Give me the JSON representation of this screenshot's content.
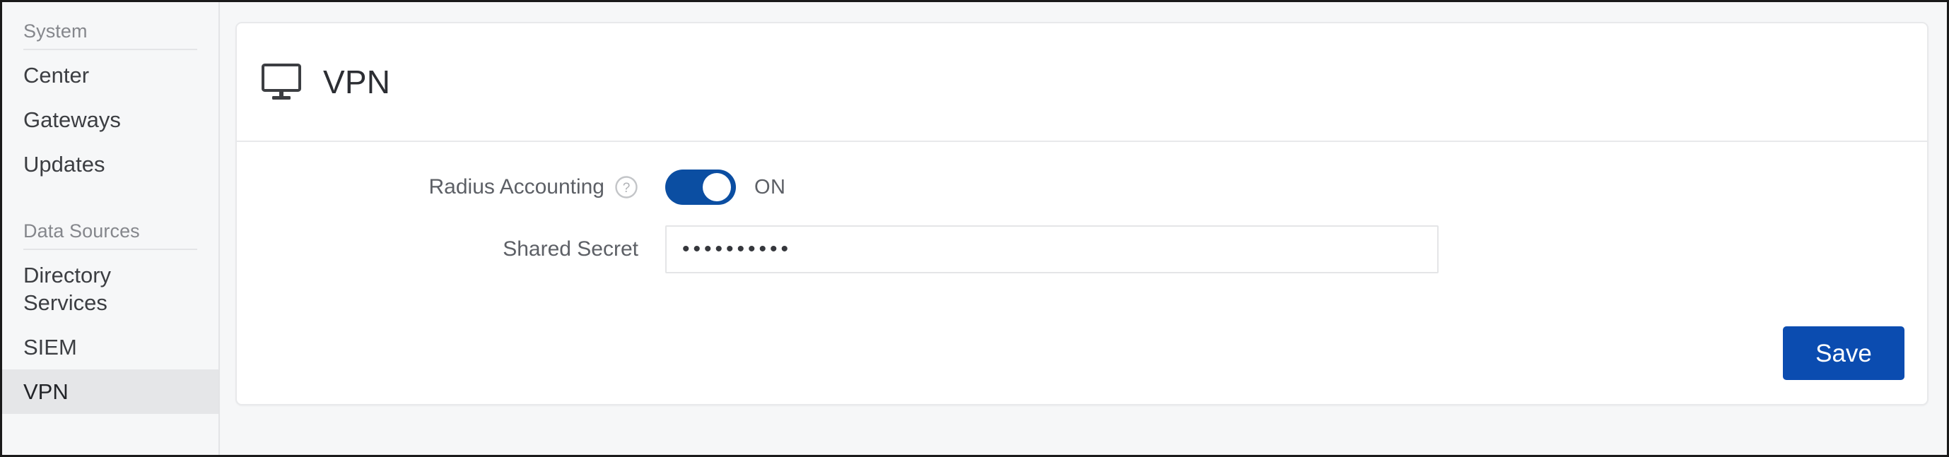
{
  "sidebar": {
    "sections": [
      {
        "title": "System",
        "items": [
          {
            "label": "Center",
            "active": false
          },
          {
            "label": "Gateways",
            "active": false
          },
          {
            "label": "Updates",
            "active": false
          }
        ]
      },
      {
        "title": "Data Sources",
        "items": [
          {
            "label": "Directory Services",
            "active": false
          },
          {
            "label": "SIEM",
            "active": false
          },
          {
            "label": "VPN",
            "active": true
          }
        ]
      }
    ]
  },
  "card": {
    "title": "VPN",
    "icon": "monitor-icon",
    "fields": {
      "radius_accounting": {
        "label": "Radius Accounting",
        "help_icon": "help-circle-icon",
        "toggle_state": "ON",
        "toggle_on": true
      },
      "shared_secret": {
        "label": "Shared Secret",
        "value": "••••••••••",
        "placeholder": ""
      }
    },
    "save_label": "Save"
  },
  "colors": {
    "accent_blue": "#0b4cb0",
    "toggle_blue": "#0b4ea2",
    "sidebar_bg": "#f6f7f8",
    "active_item_bg": "#e5e6e8"
  }
}
